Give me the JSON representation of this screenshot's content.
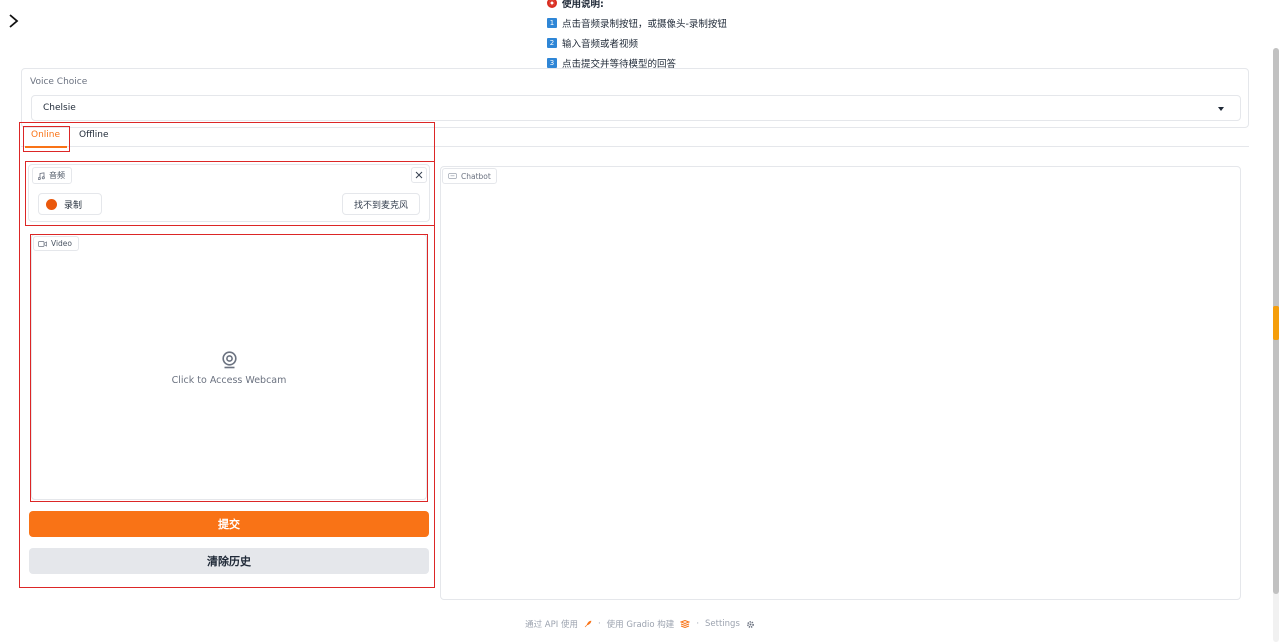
{
  "instructions": {
    "title": "使用说明:",
    "steps": [
      {
        "num": "1",
        "text": "点击音频录制按钮，或摄像头-录制按钮"
      },
      {
        "num": "2",
        "text": "输入音频或者视频"
      },
      {
        "num": "3",
        "text": "点击提交并等待模型的回答"
      }
    ]
  },
  "voice": {
    "label": "Voice Choice",
    "selected": "Chelsie"
  },
  "tabs": {
    "online": "Online",
    "offline": "Offline",
    "active": "Online"
  },
  "audio": {
    "label": "音频",
    "record_label": "录制",
    "mic_label": "找不到麦克风"
  },
  "video": {
    "label": "Video",
    "webcam_text": "Click to Access Webcam"
  },
  "buttons": {
    "submit": "提交",
    "clear": "清除历史"
  },
  "chatbot": {
    "label": "Chatbot"
  },
  "footer": {
    "api": "通过 API 使用",
    "gradio": "使用 Gradio 构建",
    "settings": "Settings",
    "separator": "·"
  },
  "colors": {
    "accent": "#f97316",
    "record": "#ea580c",
    "highlight_box": "#dc2626",
    "step_badge": "#2f86d6"
  }
}
